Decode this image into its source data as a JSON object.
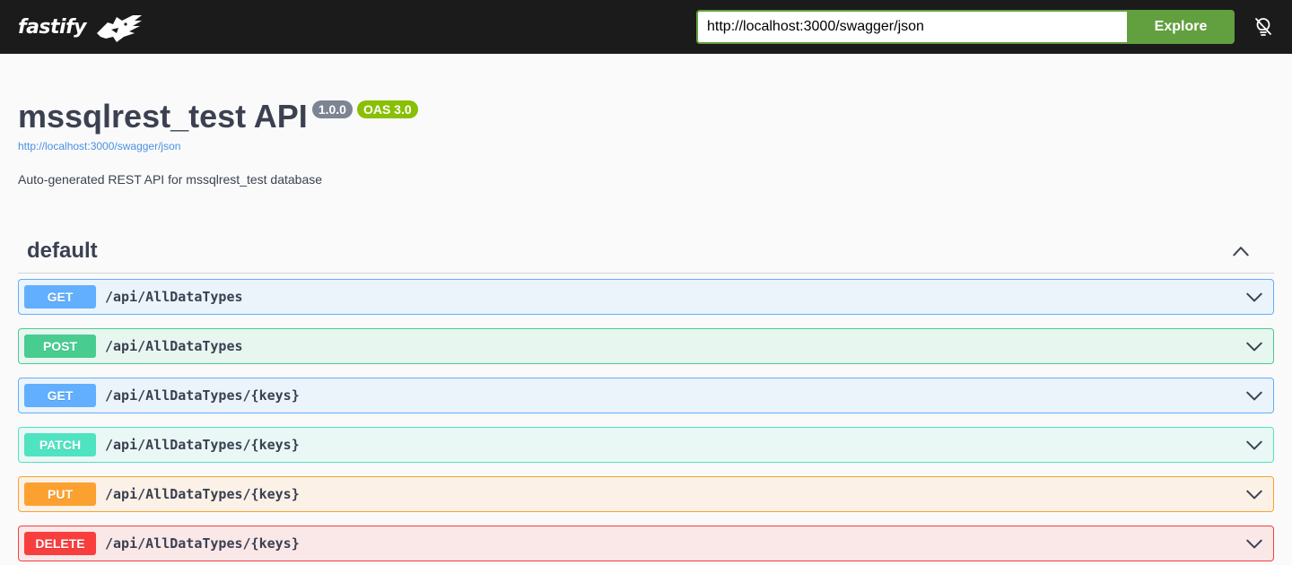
{
  "topbar": {
    "logo_text": "fastify",
    "logo_icon": "fastify-logo-icon",
    "url_value": "http://localhost:3000/swagger/json",
    "explore_label": "Explore",
    "theme_icon": "lightbulb-off-icon"
  },
  "info": {
    "title": "mssqlrest_test API",
    "version": "1.0.0",
    "oas": "OAS 3.0",
    "spec_url": "http://localhost:3000/swagger/json",
    "description": "Auto-generated REST API for mssqlrest_test database"
  },
  "tag": {
    "name": "default",
    "toggle_icon": "chevron-up-icon"
  },
  "operations": [
    {
      "method": "GET",
      "path": "/api/AllDataTypes"
    },
    {
      "method": "POST",
      "path": "/api/AllDataTypes"
    },
    {
      "method": "GET",
      "path": "/api/AllDataTypes/{keys}"
    },
    {
      "method": "PATCH",
      "path": "/api/AllDataTypes/{keys}"
    },
    {
      "method": "PUT",
      "path": "/api/AllDataTypes/{keys}"
    },
    {
      "method": "DELETE",
      "path": "/api/AllDataTypes/{keys}"
    }
  ],
  "colors": {
    "get": "#61affe",
    "post": "#49cc90",
    "patch": "#50e3c2",
    "put": "#fca130",
    "delete": "#f93e3e",
    "explore": "#62a03f",
    "topbar": "#1b1b1b"
  }
}
